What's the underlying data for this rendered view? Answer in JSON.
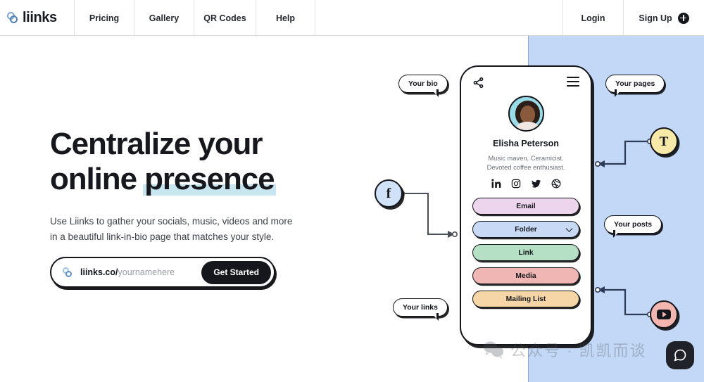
{
  "brand": {
    "name": "liinks",
    "logo_icon": "liinks-rings-logo"
  },
  "navbar": {
    "items": [
      {
        "label": "Pricing",
        "name": "pricing"
      },
      {
        "label": "Gallery",
        "name": "gallery"
      },
      {
        "label": "QR Codes",
        "name": "qr-codes"
      },
      {
        "label": "Help",
        "name": "help"
      }
    ],
    "login_label": "Login",
    "signup_label": "Sign Up",
    "signup_icon": "plus-circle-icon"
  },
  "hero": {
    "heading_line1": "Centralize your",
    "heading_line2_plain": "online ",
    "heading_line2_highlight": "presence",
    "highlight_color": "#c8e6f0",
    "subtitle_line1": "Use Liinks to gather your socials, music, videos and more",
    "subtitle_line2": "in a beautiful link-in-bio page that matches your style."
  },
  "cta": {
    "domain_prefix": "liinks.co/",
    "placeholder": "yournamehere",
    "button_label": "Get Started",
    "icon": "liinks-rings-logo"
  },
  "phone": {
    "share_icon": "share-icon",
    "menu_icon": "hamburger-menu-icon",
    "avatar_alt": "profile-photo",
    "display_name": "Elisha Peterson",
    "bio_line1": "Music maven. Ceramicist.",
    "bio_line2": "Devoted coffee enthusiast.",
    "socials": [
      {
        "name": "linkedin",
        "label": "in"
      },
      {
        "name": "instagram",
        "label": ""
      },
      {
        "name": "twitter",
        "label": ""
      },
      {
        "name": "dribbble",
        "label": ""
      }
    ],
    "links": [
      {
        "label": "Email",
        "color": "#eed5ee",
        "name": "email"
      },
      {
        "label": "Folder",
        "color": "#c8d9f5",
        "name": "folder",
        "has_chevron": true
      },
      {
        "label": "Link",
        "color": "#b6e0c5",
        "name": "link"
      },
      {
        "label": "Media",
        "color": "#f0b6b4",
        "name": "media"
      },
      {
        "label": "Mailing List",
        "color": "#f6d6a6",
        "name": "mailing-list"
      }
    ]
  },
  "callouts": [
    {
      "label": "Your bio",
      "name": "your-bio"
    },
    {
      "label": "Your pages",
      "name": "your-pages"
    },
    {
      "label": "Your posts",
      "name": "your-posts"
    },
    {
      "label": "Your links",
      "name": "your-links"
    }
  ],
  "nodes": [
    {
      "name": "facebook-node",
      "glyph": "f",
      "color": "#cfe2f7"
    },
    {
      "name": "typography-node",
      "glyph": "T",
      "color": "#f7e9a8"
    },
    {
      "name": "youtube-node",
      "glyph": "",
      "color": "#f3b5b0"
    }
  ],
  "watermark": {
    "text": "公众号 · 凯凯而谈",
    "icon": "wechat-icon"
  },
  "chat": {
    "icon": "chat-bubble-icon"
  },
  "theme": {
    "panel_blue": "#c3d8f7",
    "ink": "#14161b"
  }
}
